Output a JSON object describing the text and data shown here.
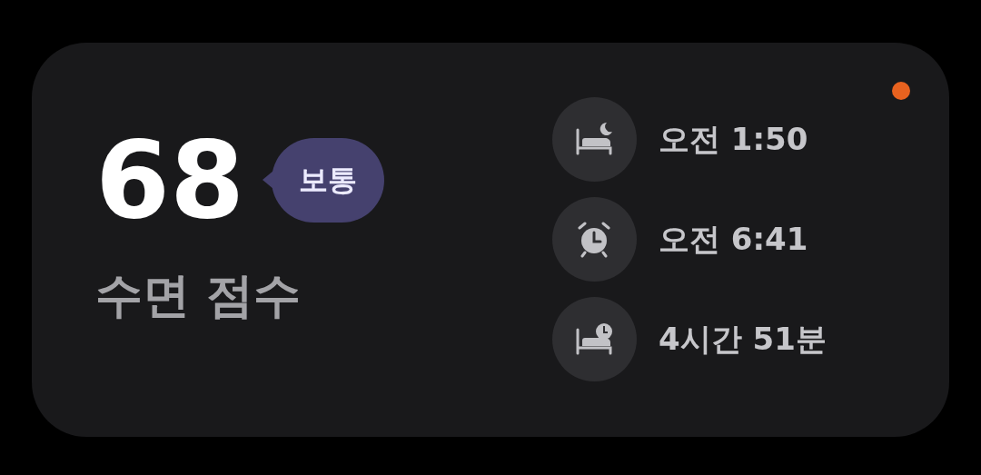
{
  "score": {
    "value": "68",
    "rating": "보통",
    "label": "수면 점수"
  },
  "stats": [
    {
      "kind": "bedtime",
      "text": "오전 1:50"
    },
    {
      "kind": "wake",
      "text": "오전 6:41"
    },
    {
      "kind": "duration",
      "text": "4시간 51분"
    }
  ]
}
